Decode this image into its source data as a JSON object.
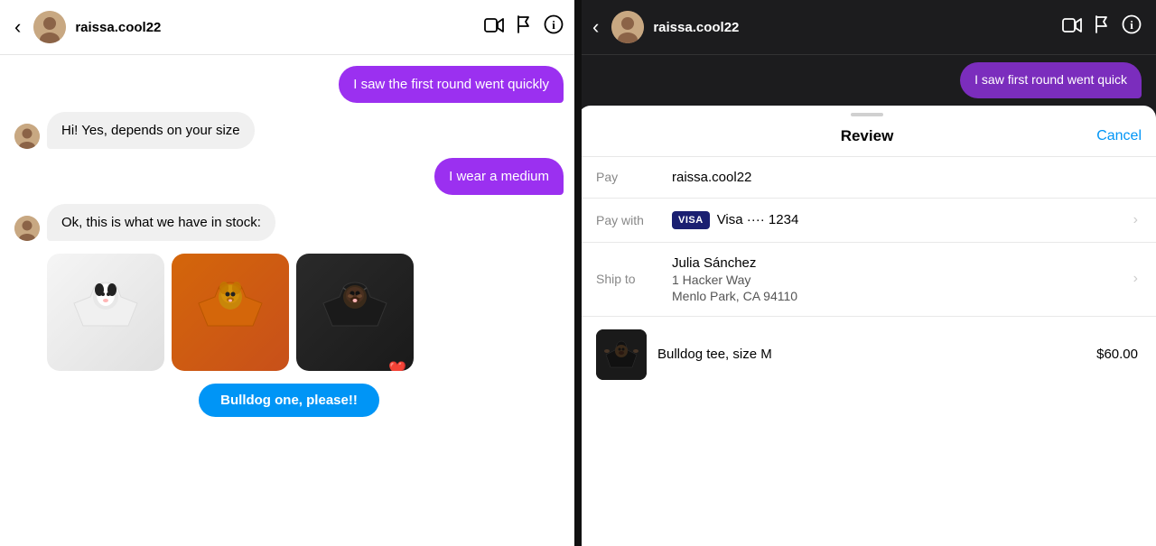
{
  "left_phone": {
    "header": {
      "back_label": "‹",
      "username": "raissa.cool22",
      "icons": [
        "video-icon",
        "flag-icon",
        "info-icon"
      ]
    },
    "messages": [
      {
        "id": "msg1",
        "type": "sent",
        "text": "I saw the first round went quickly"
      },
      {
        "id": "msg2",
        "type": "received",
        "text": "Hi! Yes, depends on your size"
      },
      {
        "id": "msg3",
        "type": "sent",
        "text": "I wear a medium"
      },
      {
        "id": "msg4",
        "type": "received",
        "text": "Ok, this is what we have in stock:"
      }
    ],
    "products": [
      {
        "id": "p1",
        "style": "white",
        "label": "White dog tee"
      },
      {
        "id": "p2",
        "style": "orange",
        "label": "Orange dog tee"
      },
      {
        "id": "p3",
        "style": "black",
        "label": "Black dog tee",
        "has_heart": true
      }
    ],
    "cta_button": "Bulldog one, please!!"
  },
  "right_phone": {
    "header": {
      "back_label": "‹",
      "username": "raissa.cool22",
      "icons": [
        "video-icon",
        "flag-icon",
        "info-icon"
      ]
    },
    "partial_message": "I saw first round went quick",
    "review_sheet": {
      "title": "Review",
      "cancel_label": "Cancel",
      "rows": [
        {
          "label": "Pay",
          "value": "raissa.cool22",
          "has_chevron": false
        },
        {
          "label": "Pay with",
          "card_brand": "VISA",
          "card_value": "Visa ···· 1234",
          "has_chevron": true
        },
        {
          "label": "Ship to",
          "address_line1": "Julia Sánchez",
          "address_line2": "1 Hacker Way",
          "address_line3": "Menlo Park, CA 94110",
          "has_chevron": true
        }
      ],
      "product_row": {
        "name": "Bulldog tee, size M",
        "price": "$60.00"
      }
    }
  }
}
